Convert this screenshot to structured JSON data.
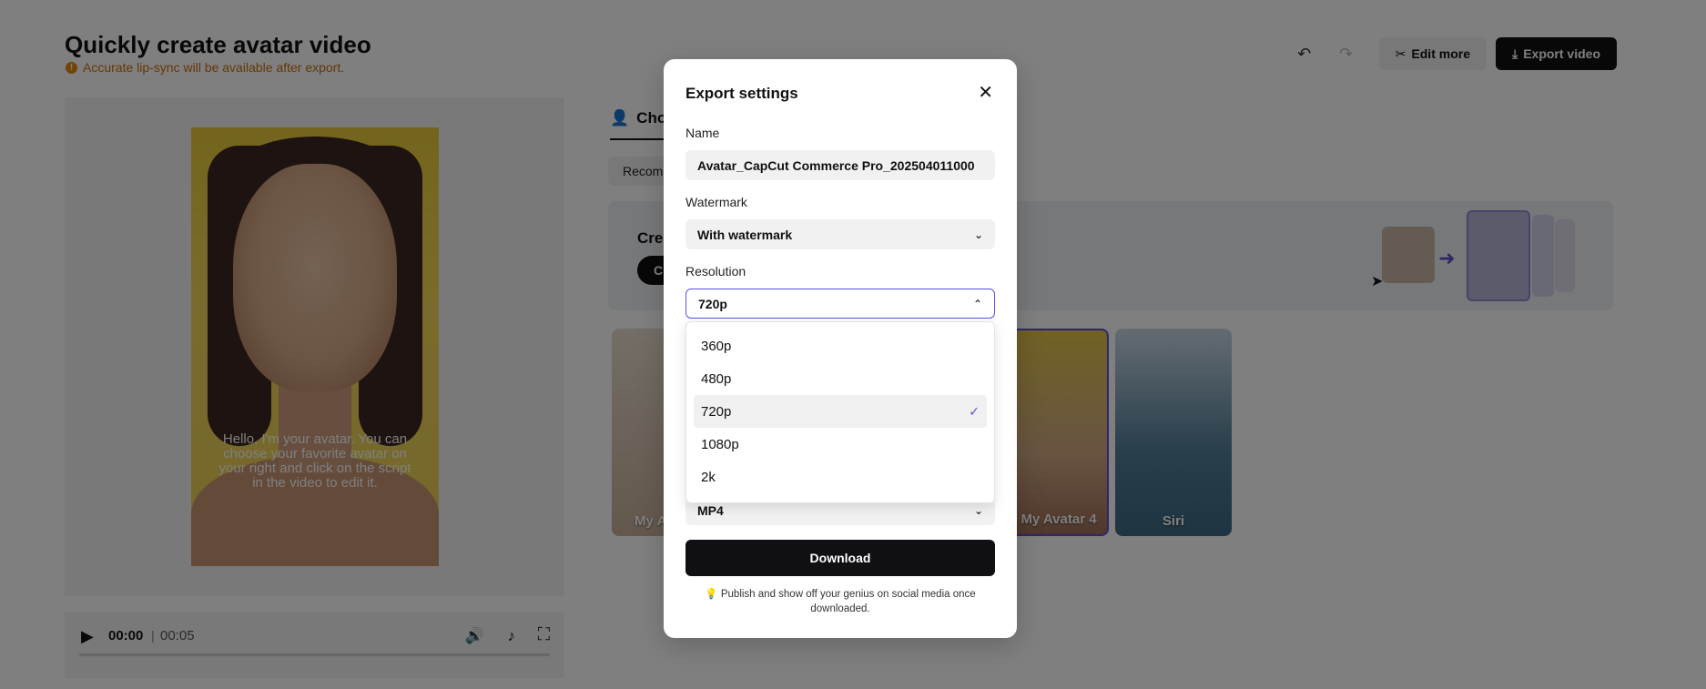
{
  "header": {
    "title": "Quickly create avatar video",
    "notice": "Accurate lip-sync will be available after export.",
    "notice_icon": "!",
    "edit_more_label": "Edit more",
    "export_label": "Export video"
  },
  "preview": {
    "subtitle": "Hello, I'm your avatar. You can choose your favorite avatar on your right and click on the script in the video to edit it.",
    "time_current": "00:00",
    "time_separator": "|",
    "time_total": "00:05"
  },
  "right_panel": {
    "tab_label": "Choo",
    "chip_label": "Recom",
    "banner_title": "Crea",
    "banner_button": "C",
    "avatars": [
      {
        "label": "My A"
      },
      {
        "label": "My Avatar 4"
      },
      {
        "label": "Siri"
      }
    ]
  },
  "modal": {
    "title": "Export settings",
    "name_label": "Name",
    "name_value": "Avatar_CapCut Commerce Pro_202504011000",
    "watermark_label": "Watermark",
    "watermark_value": "With watermark",
    "resolution_label": "Resolution",
    "resolution_value": "720p",
    "resolution_options": [
      {
        "label": "360p",
        "selected": false
      },
      {
        "label": "480p",
        "selected": false
      },
      {
        "label": "720p",
        "selected": true
      },
      {
        "label": "1080p",
        "selected": false
      },
      {
        "label": "2k",
        "selected": false
      }
    ],
    "format_value": "MP4",
    "download_label": "Download",
    "tip_icon": "💡",
    "tip_text": "Publish and show off your genius on social media once downloaded."
  },
  "colors": {
    "accent": "#5b4fe0",
    "notice": "#c8700a",
    "primary_button": "#0f0f14"
  }
}
